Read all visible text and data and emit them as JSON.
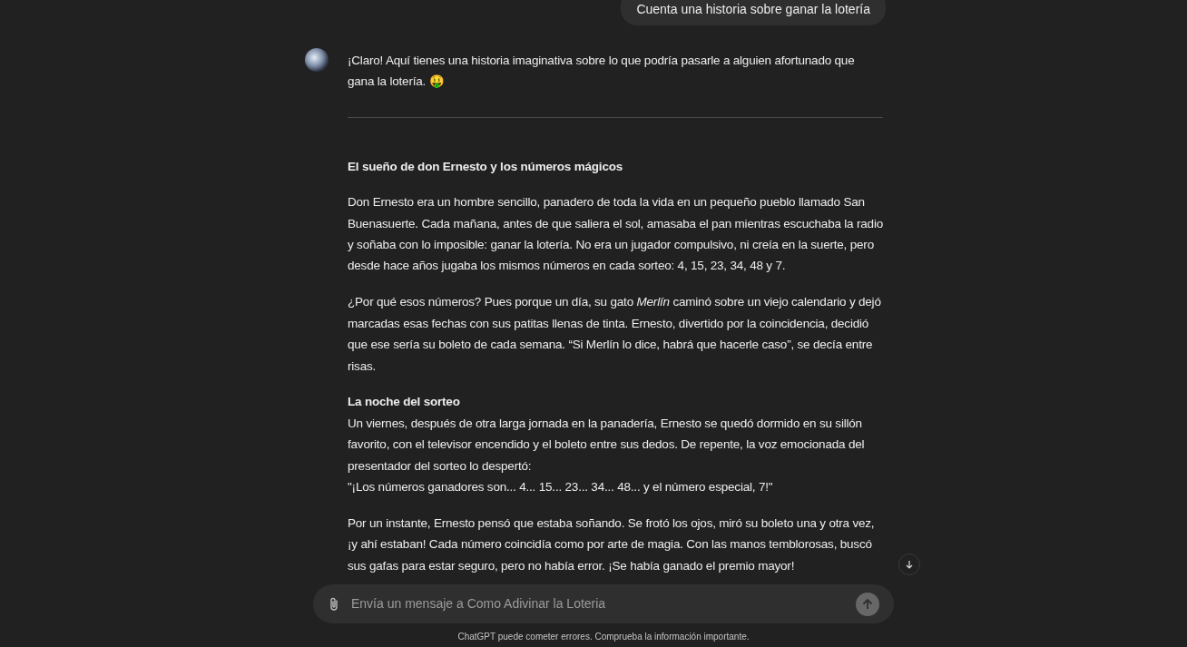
{
  "user_message": "Cuenta una historia sobre ganar la lotería",
  "reply": {
    "intro": "¡Claro! Aquí tienes una historia imaginativa sobre lo que podría pasarle a alguien afortunado que gana la lotería. 🤑",
    "blocks": [
      {
        "kind": "rule"
      },
      {
        "kind": "title",
        "text": "El sueño de don Ernesto y los números mágicos"
      },
      {
        "kind": "paragraph",
        "text": "Don Ernesto era un hombre sencillo, panadero de toda la vida en un pequeño pueblo llamado San Buenasuerte. Cada mañana, antes de que saliera el sol, amasaba el pan mientras escuchaba la radio y soñaba con lo imposible: ganar la lotería. No era un jugador compulsivo, ni creía en la suerte, pero desde hace años jugaba los mismos números en cada sorteo: 4, 15, 23, 34, 48 y 7."
      },
      {
        "kind": "paragraph",
        "text": "¿Por qué esos números? Pues porque un día, su gato *Merlín* caminó sobre un viejo calendario y dejó marcadas esas fechas con sus patitas llenas de tinta. Ernesto, divertido por la coincidencia, decidió que ese sería su boleto de cada semana. “Si Merlín lo dice, habrá que hacerle caso”, se decía entre risas."
      },
      {
        "kind": "subheading",
        "text": "La noche del sorteo"
      },
      {
        "kind": "line",
        "text": "Un viernes, después de otra larga jornada en la panadería, Ernesto se quedó dormido en su sillón favorito, con el televisor encendido y el boleto entre sus dedos. De repente, la voz emocionada del presentador del sorteo lo despertó:"
      },
      {
        "kind": "paragraph",
        "text": "\"¡Los números ganadores son... 4... 15... 23... 34... 48... y el número especial, 7!\""
      },
      {
        "kind": "paragraph",
        "text": "Por un instante, Ernesto pensó que estaba soñando. Se frotó los ojos, miró su boleto una y otra vez, ¡y ahí estaban! Cada número coincidía como por arte de magia. Con las manos temblorosas, buscó sus gafas para estar seguro, pero no había error. ¡Se había ganado el premio mayor!"
      }
    ]
  },
  "composer": {
    "placeholder": "Envía un mensaje a Como Adivinar la Loteria"
  },
  "disclaimer": "ChatGPT puede cometer errores. Comprueba la información importante."
}
